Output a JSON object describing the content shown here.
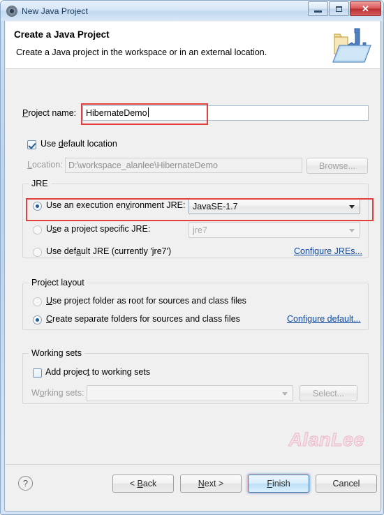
{
  "window": {
    "title": "New Java Project",
    "icon": "eclipse-wizard-icon",
    "minimize_label": "Minimize",
    "maximize_label": "Maximize",
    "close_label": "Close"
  },
  "banner": {
    "title": "Create a Java Project",
    "subtitle": "Create a Java project in the workspace or in an external location.",
    "icon": "java-project-folder-icon"
  },
  "project": {
    "name_label": "Project name:",
    "name_value": "HibernateDemo",
    "use_default_location_label": "Use default location",
    "use_default_location_checked": true,
    "location_label": "Location:",
    "location_value": "D:\\workspace_alanlee\\HibernateDemo",
    "browse_label": "Browse..."
  },
  "jre": {
    "group_title": "JRE",
    "option_execution_env": "Use an execution environment JRE:",
    "execution_env_value": "JavaSE-1.7",
    "option_project_specific": "Use a project specific JRE:",
    "project_specific_value": "jre7",
    "option_default_jre": "Use default JRE (currently 'jre7')",
    "selected": "execution_env",
    "configure_link": "Configure JREs..."
  },
  "layout": {
    "group_title": "Project layout",
    "option_project_folder_root": "Use project folder as root for sources and class files",
    "option_separate_folders": "Create separate folders for sources and class files",
    "selected": "separate_folders",
    "configure_link": "Configure default..."
  },
  "working_sets": {
    "group_title": "Working sets",
    "add_label": "Add project to working sets",
    "add_checked": false,
    "sets_label": "Working sets:",
    "sets_value": "",
    "select_label": "Select..."
  },
  "footer": {
    "help_label": "?",
    "back_label": "< Back",
    "next_label": "Next >",
    "finish_label": "Finish",
    "cancel_label": "Cancel"
  },
  "watermark": {
    "text": "AlanLee"
  },
  "colors": {
    "annotation_red": "#e2403f",
    "link_blue": "#0b47a1",
    "dialog_bg": "#f0f0f0",
    "titlebar_blue": "#c2d9ef"
  }
}
